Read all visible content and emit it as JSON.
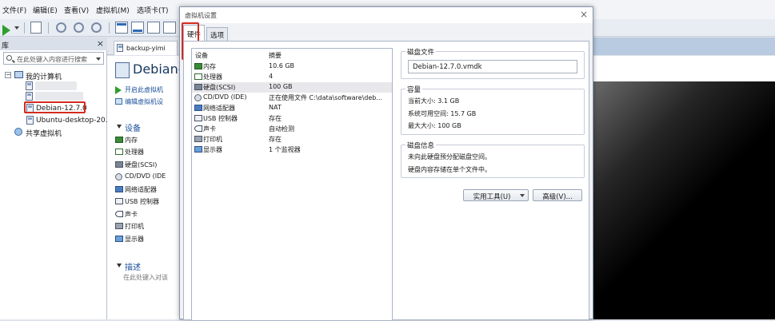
{
  "menubar": {
    "items": [
      "文件(F)",
      "编辑(E)",
      "查看(V)",
      "虚拟机(M)",
      "选项卡(T)"
    ]
  },
  "library": {
    "title": "库",
    "search_placeholder": "在此处键入内容进行搜索",
    "my_computer": "我的计算机",
    "vms": [
      "Debian-12.7.0",
      "Ubuntu-desktop-20."
    ],
    "shared": "共享虚拟机"
  },
  "vm_tab": {
    "label": "backup-yimi"
  },
  "vm_panel": {
    "title": "Debian-",
    "actions": [
      "开启此虚拟机",
      "编辑虚拟机设"
    ],
    "devices_header": "设备",
    "devices": [
      "内存",
      "处理器",
      "硬盘(SCSI)",
      "CD/DVD (IDE",
      "网络适配器",
      "USB 控制器",
      "声卡",
      "打印机",
      "显示器"
    ],
    "description_header": "描述",
    "description_placeholder": "在此处键入对该"
  },
  "dialog": {
    "title": "虚拟机设置",
    "tabs": [
      "硬件",
      "选项"
    ],
    "device_list": {
      "col_device": "设备",
      "col_summary": "摘要",
      "rows": [
        {
          "name": "内存",
          "summary": "10.6 GB",
          "icon": "memory-icon"
        },
        {
          "name": "处理器",
          "summary": "4",
          "icon": "processor-icon"
        },
        {
          "name": "硬盘(SCSI)",
          "summary": "100 GB",
          "icon": "harddisk-icon"
        },
        {
          "name": "CD/DVD (IDE)",
          "summary": "正在使用文件 C:\\data\\software\\deb...",
          "icon": "cd-dvd-icon"
        },
        {
          "name": "网络适配器",
          "summary": "NAT",
          "icon": "network-adapter-icon"
        },
        {
          "name": "USB 控制器",
          "summary": "存在",
          "icon": "usb-controller-icon"
        },
        {
          "name": "声卡",
          "summary": "自动检测",
          "icon": "sound-card-icon"
        },
        {
          "name": "打印机",
          "summary": "存在",
          "icon": "printer-icon"
        },
        {
          "name": "显示器",
          "summary": "1 个监视器",
          "icon": "display-icon"
        }
      ],
      "selected": "硬盘(SCSI)"
    },
    "disk_file": {
      "title": "磁盘文件",
      "value": "Debian-12.7.0.vmdk"
    },
    "capacity": {
      "title": "容量",
      "current_size": "当前大小: 3.1 GB",
      "system_free": "系统可用空间: 15.7 GB",
      "max_size": "最大大小: 100 GB"
    },
    "disk_info": {
      "title": "磁盘信息",
      "line1": "未向此硬盘预分配磁盘空间。",
      "line2": "硬盘内容存储在单个文件中。"
    },
    "buttons": {
      "utilities": "实用工具(U)",
      "advanced": "高级(V)..."
    }
  },
  "colors": {
    "highlight_red": "#d42a1f",
    "link_blue": "#1b4f9c"
  }
}
